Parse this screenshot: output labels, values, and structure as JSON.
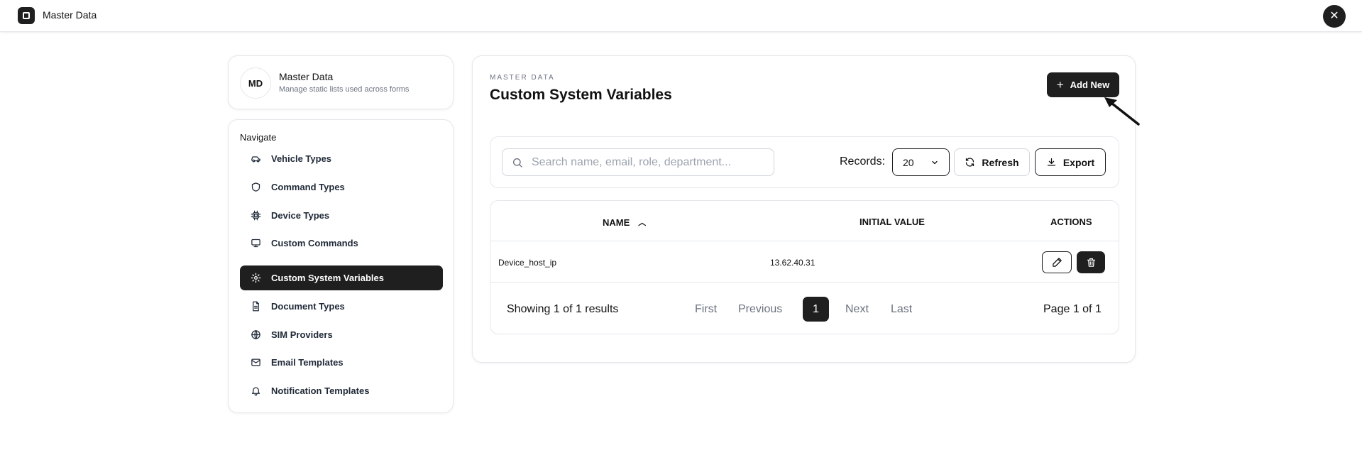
{
  "header": {
    "app_title": "Master Data",
    "close_symbol": "✕"
  },
  "profile": {
    "initials": "MD",
    "title": "Master Data",
    "subtitle": "Manage static lists used across forms"
  },
  "nav": {
    "heading": "Navigate",
    "items": [
      {
        "label": "Vehicle Types",
        "icon": "car-icon",
        "active": false
      },
      {
        "label": "Command Types",
        "icon": "shield-icon",
        "active": false
      },
      {
        "label": "Device Types",
        "icon": "chip-icon",
        "active": false
      },
      {
        "label": "Custom Commands",
        "icon": "monitor-icon",
        "active": false
      },
      {
        "label": "Custom System Variables",
        "icon": "gear-icon",
        "active": true
      },
      {
        "label": "Document Types",
        "icon": "document-icon",
        "active": false
      },
      {
        "label": "SIM Providers",
        "icon": "globe-icon",
        "active": false
      },
      {
        "label": "Email Templates",
        "icon": "mail-icon",
        "active": false
      },
      {
        "label": "Notification Templates",
        "icon": "bell-icon",
        "active": false
      }
    ]
  },
  "main": {
    "eyebrow": "MASTER DATA",
    "title": "Custom System Variables",
    "add_label": "Add New",
    "search_placeholder": "Search name, email, role, department...",
    "records_label": "Records:",
    "records_value": "20",
    "refresh_label": "Refresh",
    "export_label": "Export",
    "table": {
      "columns": {
        "name": "NAME",
        "initial_value": "INITIAL VALUE",
        "actions": "ACTIONS"
      },
      "rows": [
        {
          "name": "Device_host_ip",
          "initial_value": "13.62.40.31"
        }
      ]
    },
    "pagination": {
      "showing": "Showing 1 of 1 results",
      "first": "First",
      "previous": "Previous",
      "current": "1",
      "next": "Next",
      "last": "Last",
      "page_of": "Page 1 of 1"
    }
  }
}
